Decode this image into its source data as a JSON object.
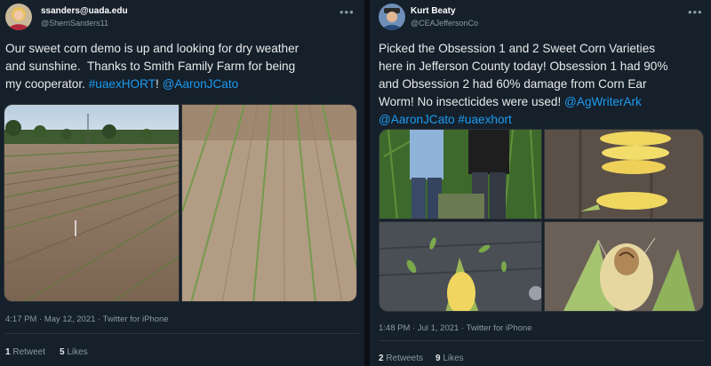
{
  "left_tweet": {
    "name": "ssanders@uada.edu",
    "handle": "@SherriSanders11",
    "more_icon": "•••",
    "text_lines": [
      "Our sweet corn demo is up and looking for dry weather",
      "and sunshine.  Thanks to Smith Family Farm for being",
      "my cooperator. "
    ],
    "hashtag": "#uaexHORT",
    "bang": "! ",
    "mention": "@AaronJCato",
    "timestamp": "4:17 PM · May 12, 2021 · Twitter for iPhone",
    "retweets_count": "1",
    "retweets_label": " Retweet",
    "likes_count": "5",
    "likes_label": " Likes"
  },
  "right_tweet": {
    "name": "Kurt Beaty",
    "handle": "@CEAJeffersonCo",
    "more_icon": "•••",
    "text_lines": [
      "Picked the Obsession 1 and 2 Sweet Corn Varieties",
      "here in Jefferson County today! Obsession 1 had 90%",
      "and Obsession 2 had 60% damage from Corn Ear",
      "Worm! No insecticides were used! "
    ],
    "mention1": "@AgWriterArk",
    "mention2": "@AaronJCato",
    "hashtag": "#uaexhort",
    "timestamp": "1:48 PM · Jul 1, 2021 · Twitter for iPhone",
    "retweets_count": "2",
    "retweets_label": " Retweets",
    "likes_count": "9",
    "likes_label": " Likes"
  }
}
